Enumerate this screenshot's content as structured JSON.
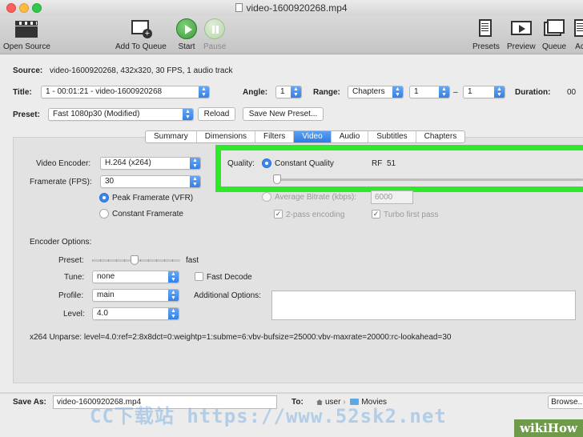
{
  "window": {
    "title": "video-1600920268.mp4"
  },
  "toolbar": {
    "open_source": "Open Source",
    "add_to_queue": "Add To Queue",
    "start": "Start",
    "pause": "Pause",
    "presets": "Presets",
    "preview": "Preview",
    "queue": "Queue",
    "activity": "Ac"
  },
  "source": {
    "label": "Source:",
    "value": "video-1600920268, 432x320, 30 FPS, 1 audio track"
  },
  "title_row": {
    "title_label": "Title:",
    "title_value": "1 - 00:01:21 - video-1600920268",
    "angle_label": "Angle:",
    "angle_value": "1",
    "range_label": "Range:",
    "range_type": "Chapters",
    "range_start": "1",
    "range_sep": "–",
    "range_end": "1",
    "duration_label": "Duration:",
    "duration_value": "00"
  },
  "preset_row": {
    "label": "Preset:",
    "value": "Fast 1080p30 (Modified)",
    "reload": "Reload",
    "save_new": "Save New Preset..."
  },
  "tabs": [
    {
      "label": "Summary",
      "active": false
    },
    {
      "label": "Dimensions",
      "active": false
    },
    {
      "label": "Filters",
      "active": false
    },
    {
      "label": "Video",
      "active": true
    },
    {
      "label": "Audio",
      "active": false
    },
    {
      "label": "Subtitles",
      "active": false
    },
    {
      "label": "Chapters",
      "active": false
    }
  ],
  "video": {
    "encoder_label": "Video Encoder:",
    "encoder_value": "H.264 (x264)",
    "framerate_label": "Framerate (FPS):",
    "framerate_value": "30",
    "peak_framerate": "Peak Framerate (VFR)",
    "constant_framerate": "Constant Framerate",
    "quality_label": "Quality:",
    "constant_quality": "Constant Quality",
    "rf_label": "RF",
    "rf_value": "51",
    "rf_slider_fraction": 0.0,
    "average_bitrate": "Average Bitrate (kbps):",
    "bitrate_value": "6000",
    "two_pass": "2-pass encoding",
    "turbo": "Turbo first pass"
  },
  "encoder_options": {
    "heading": "Encoder Options:",
    "preset_label": "Preset:",
    "preset_value": "fast",
    "preset_slider_fraction": 0.5,
    "tune_label": "Tune:",
    "tune_value": "none",
    "fast_decode": "Fast Decode",
    "profile_label": "Profile:",
    "profile_value": "main",
    "additional_label": "Additional Options:",
    "level_label": "Level:",
    "level_value": "4.0",
    "unparse": "x264 Unparse: level=4.0:ref=2:8x8dct=0:weightp=1:subme=6:vbv-bufsize=25000:vbv-maxrate=20000:rc-lookahead=30"
  },
  "save": {
    "label": "Save As:",
    "value": "video-1600920268.mp4",
    "to_label": "To:",
    "user": "user",
    "folder": "Movies",
    "browse": "Browse..."
  },
  "watermark": {
    "text": "CC下载站 https://www.52sk2.net",
    "badge": "wikiHow"
  },
  "colors": {
    "accent": "#3b86ea",
    "highlight": "#2ee82a"
  }
}
